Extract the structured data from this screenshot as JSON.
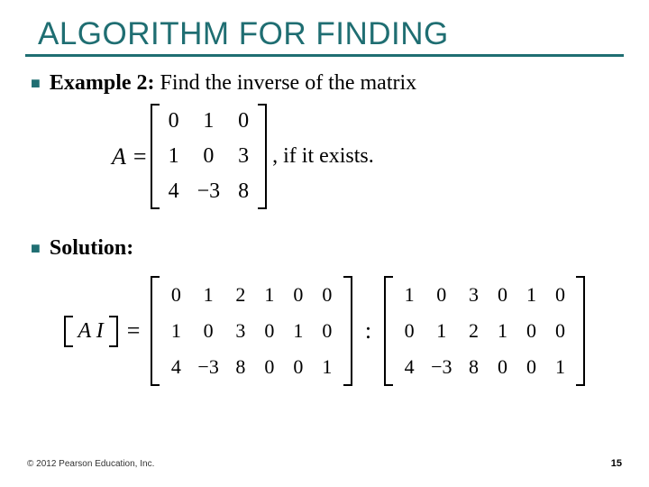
{
  "title": "ALGORITHM FOR FINDING",
  "bullets": {
    "example": {
      "label": "Example 2:",
      "text": " Find the inverse of the matrix"
    },
    "solution_label": "Solution:"
  },
  "matrixA": {
    "label": "A",
    "rows": [
      [
        "0",
        "1",
        "0"
      ],
      [
        "1",
        "0",
        "3"
      ],
      [
        "4",
        "−3",
        "8"
      ]
    ],
    "after": ", if it exists."
  },
  "augmented": {
    "label": "A  I",
    "left": [
      [
        "0",
        "1",
        "2",
        "1",
        "0",
        "0"
      ],
      [
        "1",
        "0",
        "3",
        "0",
        "1",
        "0"
      ],
      [
        "4",
        "−3",
        "8",
        "0",
        "0",
        "1"
      ]
    ],
    "right": [
      [
        "1",
        "0",
        "3",
        "0",
        "1",
        "0"
      ],
      [
        "0",
        "1",
        "2",
        "1",
        "0",
        "0"
      ],
      [
        "4",
        "−3",
        "8",
        "0",
        "0",
        "1"
      ]
    ]
  },
  "footer": "© 2012 Pearson Education, Inc.",
  "page": "15",
  "chart_data": {
    "type": "table",
    "title": "Matrix inverse example (A and augmented [A I] with one row-swap step)",
    "A": [
      [
        0,
        1,
        0
      ],
      [
        1,
        0,
        3
      ],
      [
        4,
        -3,
        8
      ]
    ],
    "AI_initial": [
      [
        0,
        1,
        2,
        1,
        0,
        0
      ],
      [
        1,
        0,
        3,
        0,
        1,
        0
      ],
      [
        4,
        -3,
        8,
        0,
        0,
        1
      ]
    ],
    "AI_after_step": [
      [
        1,
        0,
        3,
        0,
        1,
        0
      ],
      [
        0,
        1,
        2,
        1,
        0,
        0
      ],
      [
        4,
        -3,
        8,
        0,
        0,
        1
      ]
    ]
  }
}
